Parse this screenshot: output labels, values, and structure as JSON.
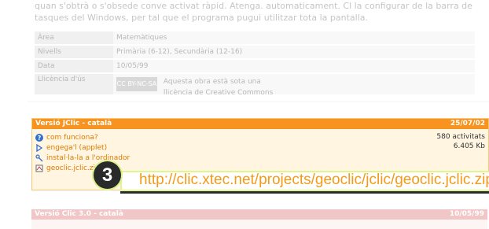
{
  "intro": {
    "text": "quan s'obtrà o s'obsede conve activat ràpid. Atenga. automaticament. Cl la configurar de la barra de tasques del Windows, per tal que el programa pugui utilitzar tota la pantalla."
  },
  "meta": [
    {
      "key": "Àrea",
      "value": "Matemàtiques"
    },
    {
      "key": "Nivells",
      "value": "Primària (6-12), Secundària (12-16)"
    },
    {
      "key": "Data",
      "value": "10/05/99"
    }
  ],
  "license": {
    "key": "Llicència d'ús",
    "badge": "CC BY-NC-SA",
    "text": "Aquesta obra està sota una llicència de Creative Commons"
  },
  "jclic_panel": {
    "title": "Versió JClic - català",
    "date": "25/07/02",
    "activities": "580 activitats",
    "size": "6.405 Kb",
    "links": {
      "how": "com funciona?",
      "applet": "engega'l (applet)",
      "install": "instal·la-la a l'ordinador",
      "download": "geoclic.jclic.zip"
    },
    "colors": {
      "header": "#f7931e",
      "link": "#e07a00"
    }
  },
  "callout": {
    "number": "3",
    "url": "http://clic.xtec.net/projects/geoclic/jclic/geoclic.jclic.zip"
  },
  "clic_panel": {
    "title": "Versió Clic 3.0 - català",
    "date": "10/05/99"
  }
}
